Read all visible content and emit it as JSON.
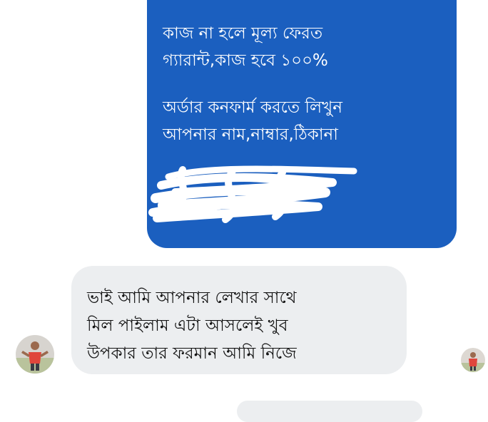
{
  "sent_message": {
    "paragraph1": [
      "কাজ না হলে মূল্য ফেরত",
      "গ্যারান্ট,কাজ হবে ১০০%"
    ],
    "paragraph2": [
      "অর্ডার কনফার্ম করতে লিখুন",
      "আপনার নাম,নাম্বার,ঠিকানা"
    ],
    "bubble_color": "#1b5fbf",
    "text_color": "#ffffff"
  },
  "received_message": {
    "lines": [
      "ভাই আমি আপনার লেখার সাথে",
      "মিল পাইলাম এটা আসলেই খুব",
      "উপকার তার ফরমান আমি নিজে"
    ],
    "bubble_color": "#eceef0",
    "text_color": "#111111"
  },
  "icons": {
    "redaction": "scribble-redaction",
    "sender_avatar": "user-avatar",
    "seen_avatar": "seen-indicator-avatar"
  }
}
